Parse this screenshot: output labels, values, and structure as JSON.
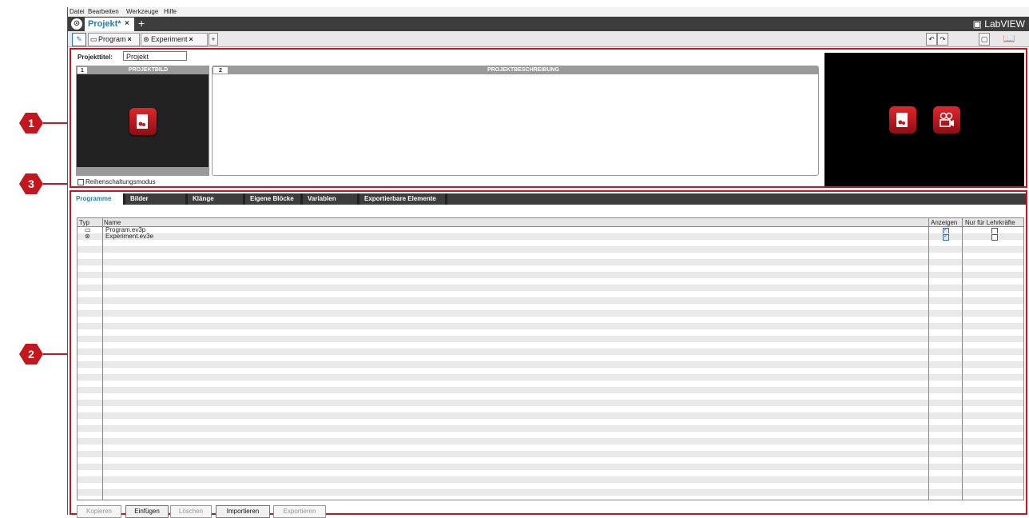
{
  "menu": [
    "Datei",
    "Bearbeiten",
    "Werkzeuge",
    "Hilfe"
  ],
  "project_tab": {
    "label": "Projekt*",
    "close": "×"
  },
  "brand": "LabVIEW",
  "file_tabs": [
    {
      "label": "Program",
      "close": "×",
      "icon": "program-icon"
    },
    {
      "label": "Experiment",
      "close": "×",
      "icon": "experiment-icon"
    }
  ],
  "add_tab": "+",
  "properties": {
    "title_label": "Projekttitel:",
    "title_value": "Projekt",
    "panel1_num": "1",
    "panel1_head": "PROJEKTBILD",
    "panel2_num": "2",
    "panel2_head": "PROJEKTBESCHREIBUNG",
    "daisy_chain_label": "Reihenschaltungsmodus",
    "daisy_chain_checked": false
  },
  "content_tabs": [
    "Programme",
    "Bilder",
    "Klänge",
    "Eigene Blöcke",
    "Variablen",
    "Exportierbare Elemente"
  ],
  "active_tab": "Programme",
  "grid": {
    "headers": {
      "type": "Typ",
      "name": "Name",
      "show": "Anzeigen",
      "teacher": "Nur für Lehrkräfte"
    },
    "rows": [
      {
        "icon": "program-icon",
        "name": "Program.ev3p",
        "show": true,
        "teacher": false
      },
      {
        "icon": "experiment-icon",
        "name": "Experiment.ev3e",
        "show": true,
        "teacher": false
      }
    ]
  },
  "buttons": [
    {
      "label": "Kopieren",
      "enabled": false
    },
    {
      "label": "Einfügen",
      "enabled": true
    },
    {
      "label": "Löschen",
      "enabled": false
    },
    {
      "label": "Importieren",
      "enabled": true
    },
    {
      "label": "Exportieren",
      "enabled": false
    }
  ],
  "callouts": [
    "1",
    "3",
    "2"
  ],
  "colors": {
    "accent": "#c4161c",
    "tab_active": "#1a7fc1",
    "dark": "#3d3d3d"
  }
}
